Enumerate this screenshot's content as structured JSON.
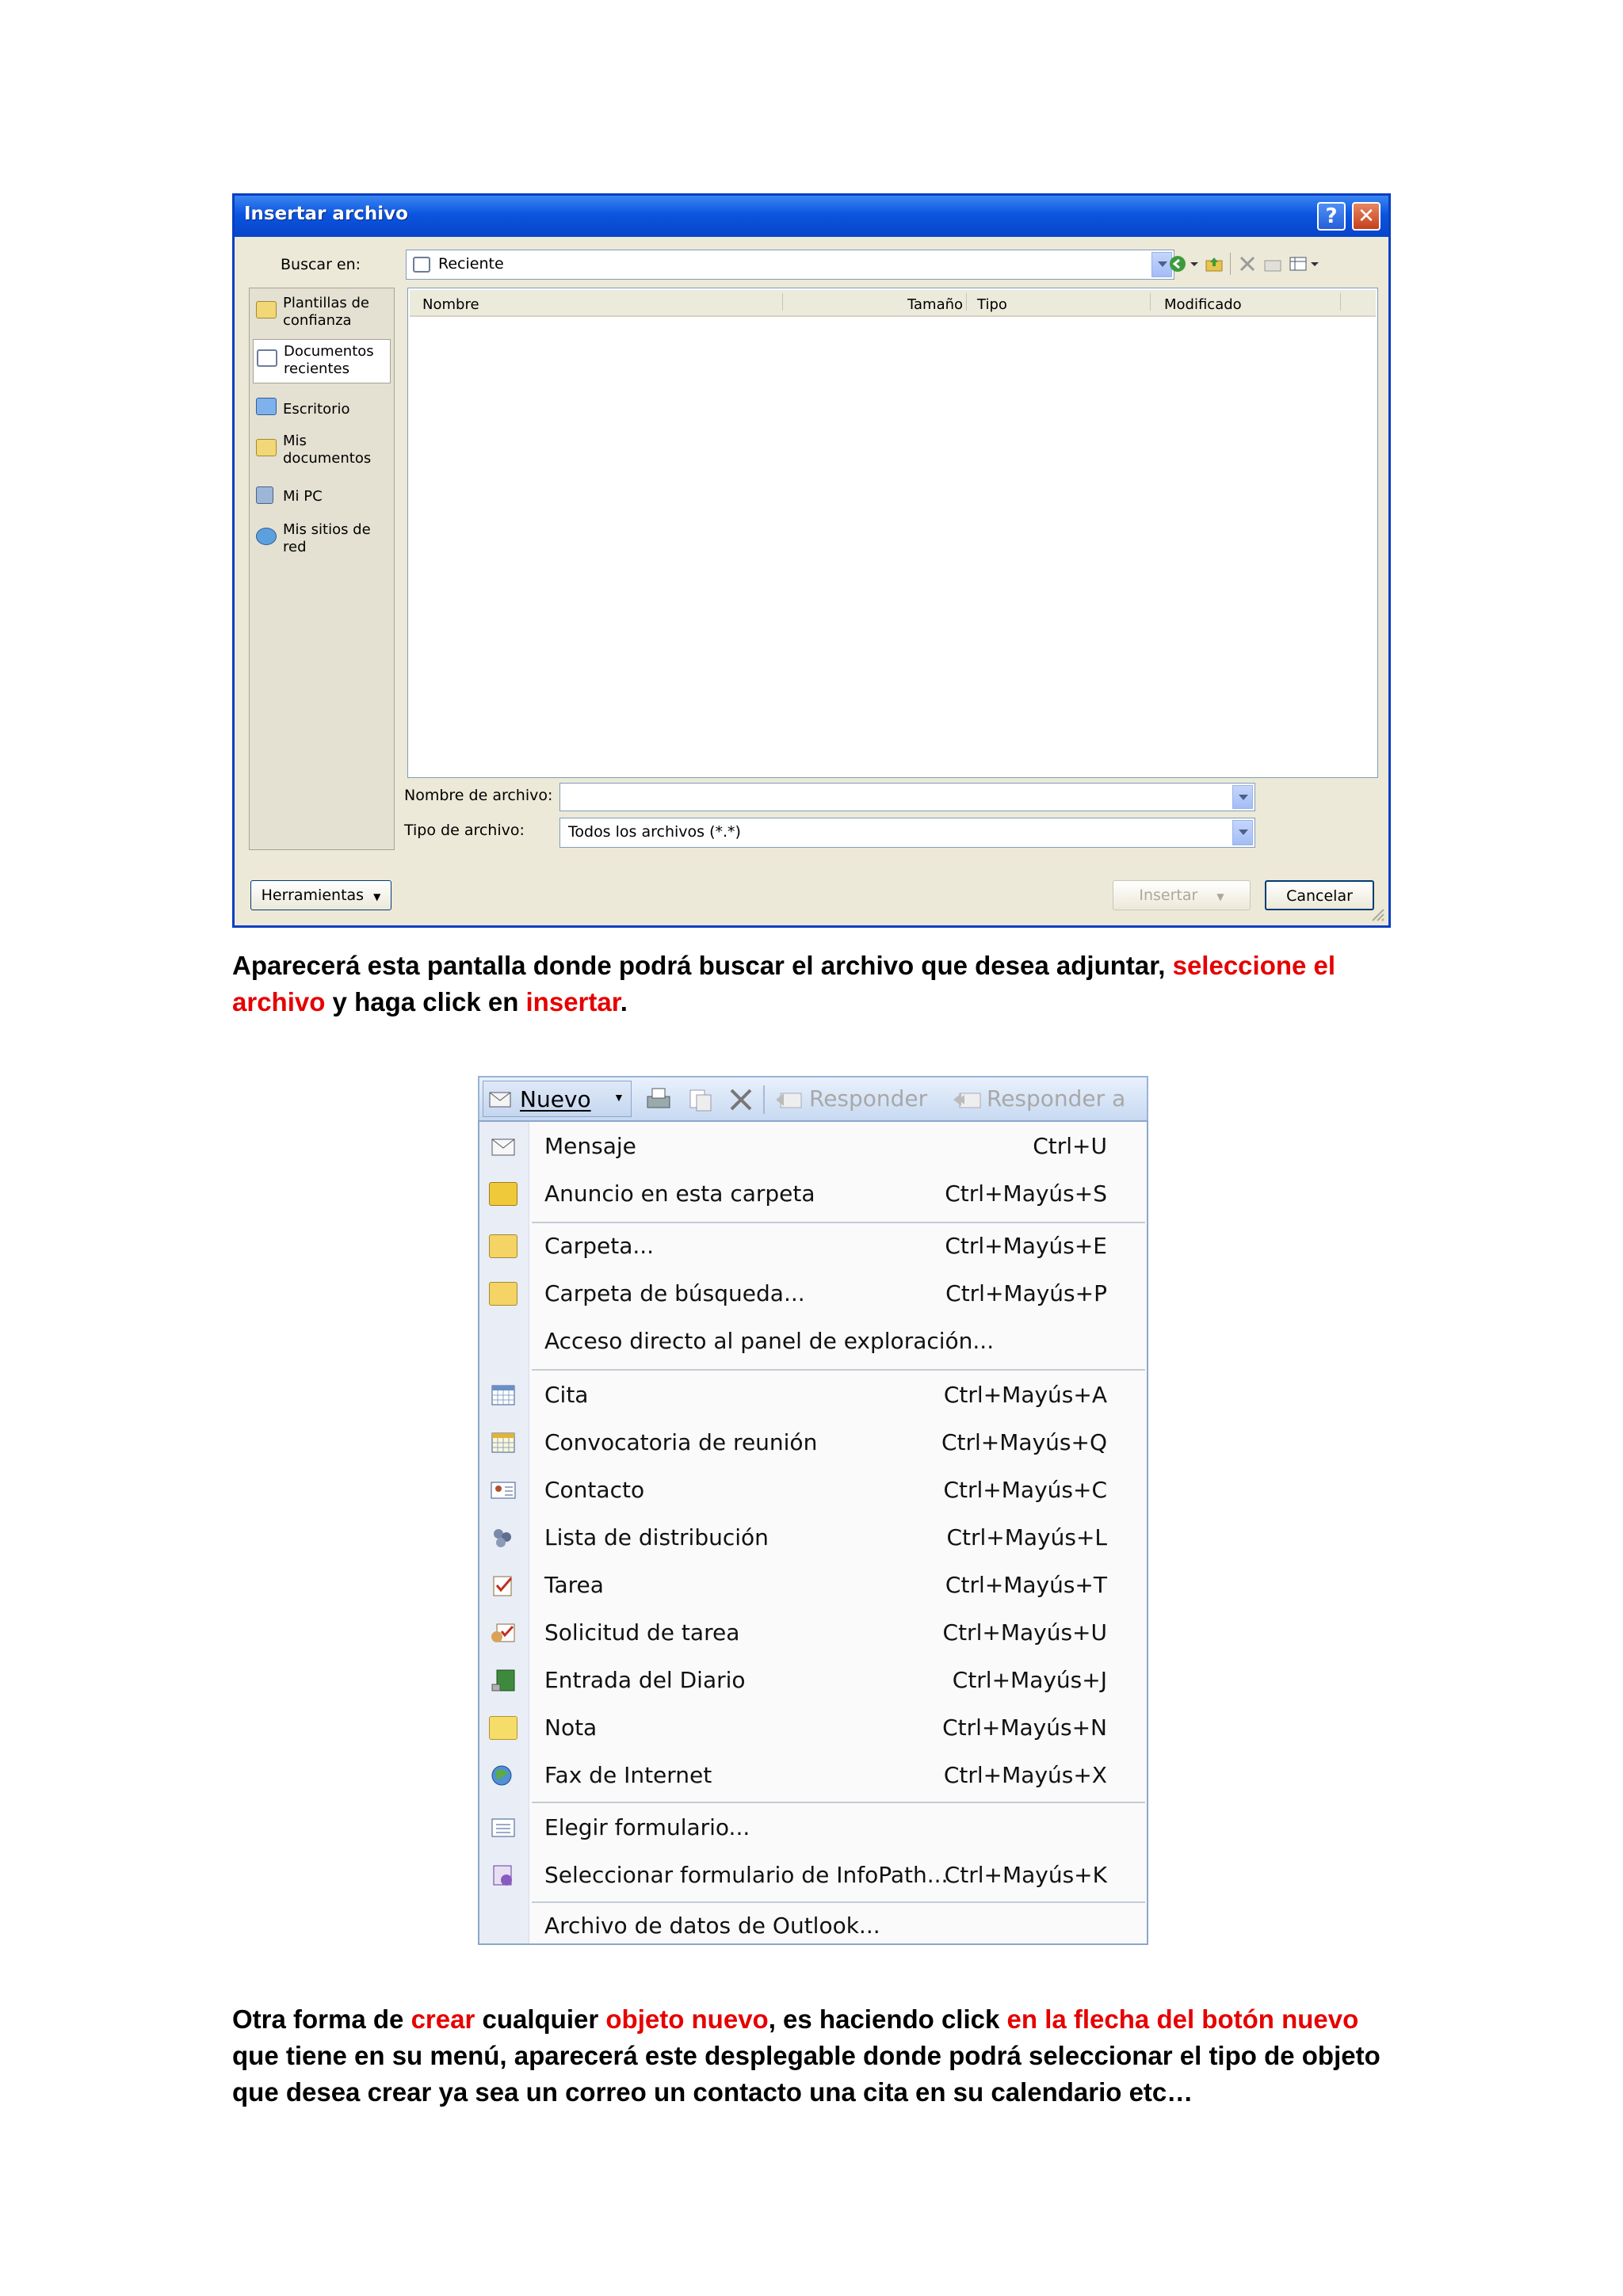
{
  "dialog": {
    "title": "Insertar archivo",
    "help_glyph": "?",
    "close_glyph": "✕",
    "look_in_label": "Buscar en:",
    "look_in_value": "Reciente",
    "places": [
      {
        "line1": "Plantillas de",
        "line2": "confianza",
        "icon": "folder-icon"
      },
      {
        "line1": "Documentos",
        "line2": "recientes",
        "icon": "recent-documents-icon"
      },
      {
        "line1": "Escritorio",
        "line2": "",
        "icon": "desktop-icon"
      },
      {
        "line1": "Mis",
        "line2": "documentos",
        "icon": "my-documents-icon"
      },
      {
        "line1": "Mi PC",
        "line2": "",
        "icon": "my-computer-icon"
      },
      {
        "line1": "Mis sitios de",
        "line2": "red",
        "icon": "network-places-icon"
      }
    ],
    "columns": {
      "name": "Nombre",
      "size": "Tamaño",
      "type": "Tipo",
      "modified": "Modificado"
    },
    "filename_label": "Nombre de archivo:",
    "filename_value": "",
    "filetype_label": "Tipo de archivo:",
    "filetype_value": "Todos los archivos (*.*)",
    "tools_button": "Herramientas",
    "insert_button": "Insertar",
    "cancel_button": "Cancelar"
  },
  "paragraph1": {
    "part1": "Aparecerá esta pantalla donde podrá buscar el archivo que desea adjuntar, ",
    "highlight1": "seleccione el archivo",
    "part2": " y haga click en ",
    "highlight2": "insertar",
    "part3": "."
  },
  "menu": {
    "toolbar": {
      "new_label": "Nuevo",
      "reply_label": "Responder",
      "reply_all_label": "Responder a"
    },
    "items": [
      {
        "label": "Mensaje",
        "shortcut": "Ctrl+U",
        "icon": "message-icon"
      },
      {
        "label": "Anuncio en esta carpeta",
        "shortcut": "Ctrl+Mayús+S",
        "icon": "post-icon"
      },
      {
        "label": "Carpeta...",
        "shortcut": "Ctrl+Mayús+E",
        "icon": "folder-icon"
      },
      {
        "label": "Carpeta de búsqueda...",
        "shortcut": "Ctrl+Mayús+P",
        "icon": "search-folder-icon"
      },
      {
        "label": "Acceso directo al panel de exploración...",
        "shortcut": "",
        "icon": ""
      },
      {
        "label": "Cita",
        "shortcut": "Ctrl+Mayús+A",
        "icon": "appointment-icon"
      },
      {
        "label": "Convocatoria de reunión",
        "shortcut": "Ctrl+Mayús+Q",
        "icon": "meeting-icon"
      },
      {
        "label": "Contacto",
        "shortcut": "Ctrl+Mayús+C",
        "icon": "contact-icon"
      },
      {
        "label": "Lista de distribución",
        "shortcut": "Ctrl+Mayús+L",
        "icon": "distribution-list-icon"
      },
      {
        "label": "Tarea",
        "shortcut": "Ctrl+Mayús+T",
        "icon": "task-icon"
      },
      {
        "label": "Solicitud de tarea",
        "shortcut": "Ctrl+Mayús+U",
        "icon": "task-request-icon"
      },
      {
        "label": "Entrada del Diario",
        "shortcut": "Ctrl+Mayús+J",
        "icon": "journal-icon"
      },
      {
        "label": "Nota",
        "shortcut": "Ctrl+Mayús+N",
        "icon": "note-icon"
      },
      {
        "label": "Fax de Internet",
        "shortcut": "Ctrl+Mayús+X",
        "icon": "fax-icon"
      },
      {
        "label": "Elegir formulario...",
        "shortcut": "",
        "icon": "form-icon"
      },
      {
        "label": "Seleccionar formulario de InfoPath...",
        "shortcut": "Ctrl+Mayús+K",
        "icon": "infopath-icon"
      },
      {
        "label": "Archivo de datos de Outlook...",
        "shortcut": "",
        "icon": ""
      }
    ]
  },
  "paragraph2": {
    "part1": "Otra forma de ",
    "highlight1": "crear",
    "part2": " cualquier ",
    "highlight2": "objeto nuevo",
    "part3": ", es haciendo click ",
    "highlight3": "en la flecha del botón nuevo",
    "part4": " que tiene en su menú, aparecerá este desplegable donde podrá seleccionar el tipo de objeto que desea crear ya sea un correo un contacto una cita en su calendario etc…"
  },
  "colors": {
    "highlight": "#e60000",
    "xp_title": "#0b55e0"
  }
}
